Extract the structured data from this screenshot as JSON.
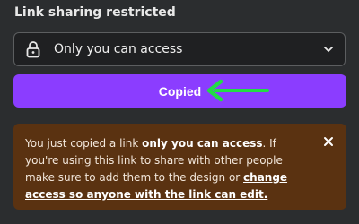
{
  "section": {
    "title": "Link sharing restricted"
  },
  "access_select": {
    "value": "Only you can access",
    "icon": "lock-icon"
  },
  "copied_button": {
    "label": "Copied"
  },
  "banner": {
    "text_before": "You just copied a link ",
    "text_bold": "only you can access",
    "text_middle": ". If you're using this link to share with other people make sure to add them to the design or ",
    "link_text": "change access so anyone with the link can edit.",
    "close_icon": "close-icon"
  },
  "colors": {
    "background": "#2b2d2f",
    "button": "#8b3dff",
    "banner": "#5a3211",
    "arrow": "#22dd44"
  }
}
